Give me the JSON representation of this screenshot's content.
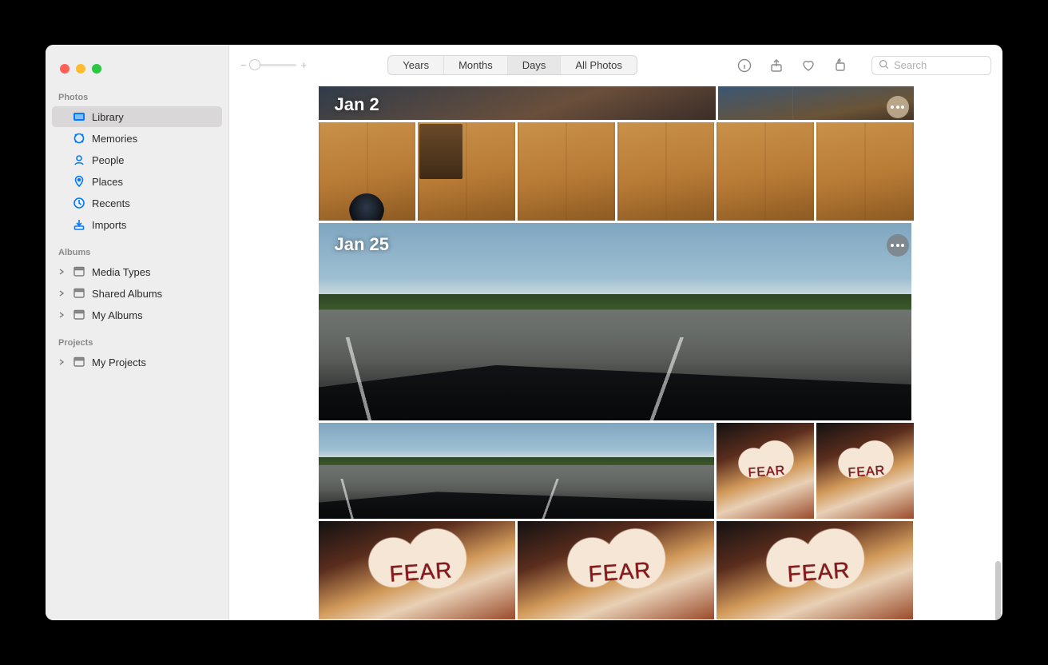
{
  "toolbar": {
    "zoom": {
      "minus": "−",
      "plus": "+"
    },
    "segments": {
      "years": "Years",
      "months": "Months",
      "days": "Days",
      "all": "All Photos",
      "active": "days"
    },
    "search_placeholder": "Search"
  },
  "sidebar": {
    "sections": {
      "photos": {
        "heading": "Photos",
        "items": [
          {
            "label": "Library",
            "key": "library",
            "active": true
          },
          {
            "label": "Memories",
            "key": "memories",
            "active": false
          },
          {
            "label": "People",
            "key": "people",
            "active": false
          },
          {
            "label": "Places",
            "key": "places",
            "active": false
          },
          {
            "label": "Recents",
            "key": "recents",
            "active": false
          },
          {
            "label": "Imports",
            "key": "imports",
            "active": false
          }
        ]
      },
      "albums": {
        "heading": "Albums",
        "items": [
          {
            "label": "Media Types",
            "key": "media-types"
          },
          {
            "label": "Shared Albums",
            "key": "shared-albums"
          },
          {
            "label": "My Albums",
            "key": "my-albums"
          }
        ]
      },
      "projects": {
        "heading": "Projects",
        "items": [
          {
            "label": "My Projects",
            "key": "my-projects"
          }
        ]
      }
    }
  },
  "days": {
    "jan2": {
      "label": "Jan 2"
    },
    "jan25": {
      "label": "Jan 25"
    }
  },
  "mural_word": "FEAR"
}
